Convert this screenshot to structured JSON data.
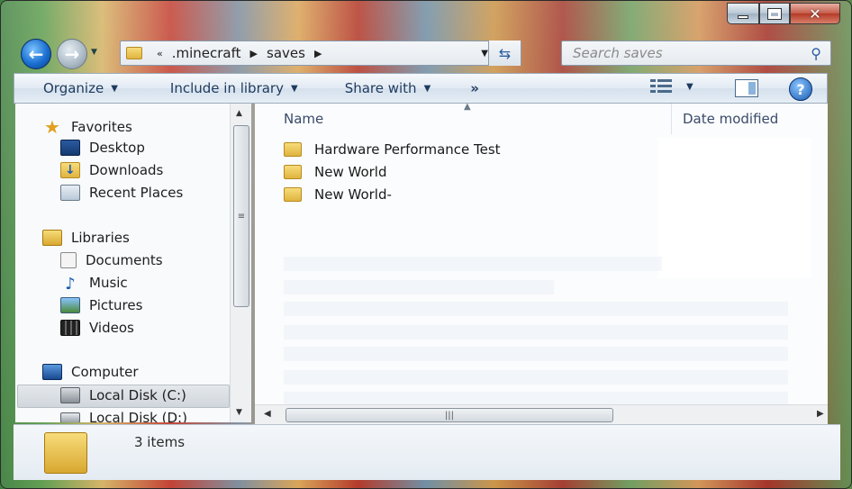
{
  "window": {
    "caption": {
      "minimize": "_",
      "maximize": "□",
      "close": "✕"
    }
  },
  "nav": {
    "back_label": "←",
    "forward_label": "→",
    "breadcrumb": {
      "overflow": "«",
      "items": [
        ".minecraft",
        "saves"
      ],
      "sep": "▶"
    },
    "search": {
      "placeholder": "Search saves"
    }
  },
  "toolbar": {
    "organize": "Organize",
    "include_in_library": "Include in library",
    "share_with": "Share with",
    "more": "»"
  },
  "sidebar": {
    "favorites": {
      "label": "Favorites",
      "items": [
        {
          "label": "Desktop",
          "icon": "desktop-icon"
        },
        {
          "label": "Downloads",
          "icon": "downloads-icon"
        },
        {
          "label": "Recent Places",
          "icon": "recent-places-icon"
        }
      ]
    },
    "libraries": {
      "label": "Libraries",
      "items": [
        {
          "label": "Documents",
          "icon": "documents-icon"
        },
        {
          "label": "Music",
          "icon": "music-icon"
        },
        {
          "label": "Pictures",
          "icon": "pictures-icon"
        },
        {
          "label": "Videos",
          "icon": "videos-icon"
        }
      ]
    },
    "computer": {
      "label": "Computer",
      "items": [
        {
          "label": "Local Disk (C:)",
          "icon": "local-disk-icon"
        },
        {
          "label": "Local Disk (D:)",
          "icon": "local-disk-icon"
        }
      ]
    }
  },
  "content": {
    "columns": {
      "name": "Name",
      "date_modified": "Date modified"
    },
    "files": [
      {
        "name": "Hardware Performance Test",
        "icon": "folder-icon"
      },
      {
        "name": "New World",
        "icon": "folder-icon"
      },
      {
        "name": "New World-",
        "icon": "folder-icon"
      }
    ]
  },
  "details": {
    "item_count": "3 items"
  }
}
